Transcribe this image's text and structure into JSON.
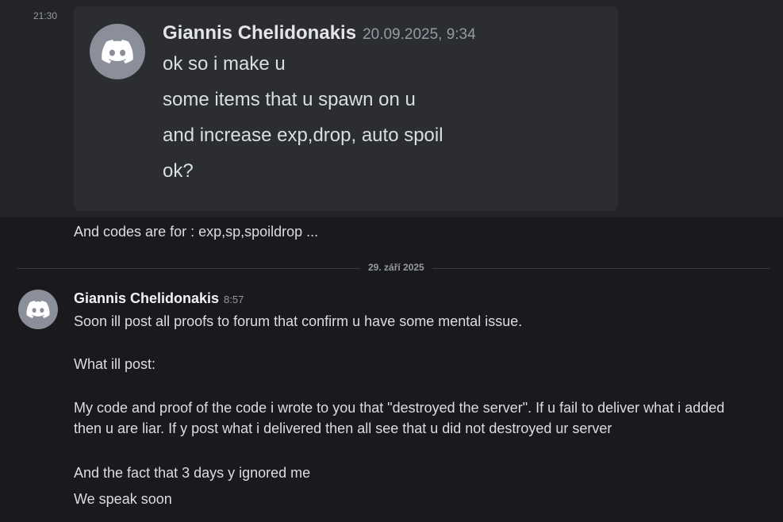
{
  "first_message": {
    "timestamp": "21:30",
    "embed": {
      "avatar_icon": "discord-logo-icon",
      "author": "Giannis Chelidonakis",
      "date": "20.09.2025, 9:34",
      "lines": [
        "ok so i make u",
        "some items that u spawn on u",
        "and increase exp,drop, auto spoil",
        "ok?"
      ]
    },
    "text": "And codes are for : exp,sp,spoildrop ..."
  },
  "date_divider": "29. září 2025",
  "second_message": {
    "avatar_icon": "discord-logo-icon",
    "author": "Giannis Chelidonakis",
    "time": "8:57",
    "lines": [
      "Soon ill post all proofs to forum that confirm  u have some mental issue.",
      "What ill post:",
      "My code and proof of the code i wrote to you that \"destroyed the server\". If u fail to deliver what i added",
      "then u are liar. If y post what i delivered then all see that u did not destroyed ur server",
      "And the fact that 3 days y ignored me",
      "We speak soon"
    ]
  },
  "toolbar": {
    "icons": [
      "emoji-reaction-icon",
      "emoji-reaction-icon",
      "emoji-reaction-icon",
      "add-reaction-icon",
      "reply-icon",
      "more-icon"
    ]
  },
  "colors": {
    "background": "#1a1a1e",
    "hover_background": "#232328",
    "embed_background": "#2b2d31",
    "avatar": "#8b8f99",
    "text": "#dbdee1",
    "muted": "#949ba4"
  }
}
